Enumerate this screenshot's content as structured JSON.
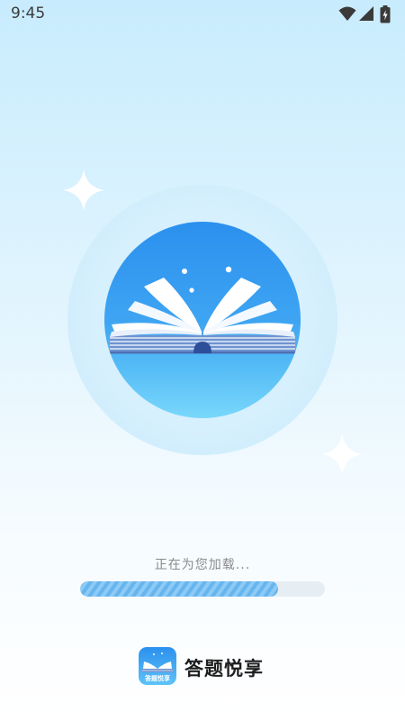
{
  "status_bar": {
    "time": "9:45",
    "icons": [
      "wifi-icon",
      "cellular-signal-icon",
      "battery-charging-icon"
    ]
  },
  "splash": {
    "illustration": "open-book-icon",
    "loading_text": "正在为您加载...",
    "progress_percent": 81
  },
  "brand": {
    "app_icon": "app-logo-icon",
    "app_icon_label": "答题悦享",
    "app_name": "答题悦享"
  },
  "colors": {
    "accent": "#2b90ee",
    "progress": "#67b5ee",
    "track": "#e6eef4",
    "text_muted": "#8a8a8a"
  }
}
